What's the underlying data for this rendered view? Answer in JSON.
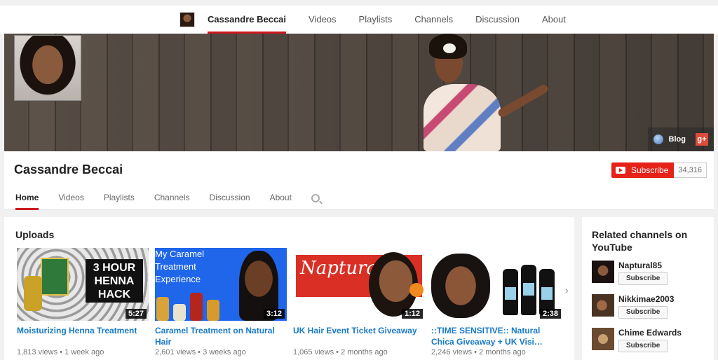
{
  "topnav": {
    "tabs": [
      {
        "label": "Cassandre Beccai",
        "active": true
      },
      {
        "label": "Videos"
      },
      {
        "label": "Playlists"
      },
      {
        "label": "Channels"
      },
      {
        "label": "Discussion"
      },
      {
        "label": "About"
      }
    ]
  },
  "banner": {
    "blog_label": "Blog",
    "gplus_label": "g+"
  },
  "channel": {
    "name": "Cassandre Beccai",
    "subscribe_label": "Subscribe",
    "subscriber_count": "34,316",
    "tabs": [
      "Home",
      "Videos",
      "Playlists",
      "Channels",
      "Discussion",
      "About"
    ]
  },
  "uploads": {
    "heading": "Uploads",
    "videos": [
      {
        "title": "Moisturizing Henna Treatment",
        "views": "1,813 views",
        "age": "1 week ago",
        "duration": "5:27",
        "thumb_text": "3 HOUR HENNA HACK"
      },
      {
        "title": "Caramel Treatment on Natural Hair",
        "views": "2,601 views",
        "age": "3 weeks ago",
        "duration": "3:12",
        "thumb_text": "My Caramel Treatment Experience"
      },
      {
        "title": "UK Hair Event Ticket Giveaway",
        "views": "1,065 views",
        "age": "2 months ago",
        "duration": "1:12",
        "thumb_text": "Napturally"
      },
      {
        "title": "::TIME SENSITIVE:: Natural Chica Giveaway + UK Visi…",
        "views": "2,246 views",
        "age": "2 months ago",
        "duration": "2:38"
      }
    ]
  },
  "related": {
    "heading": "Related channels on YouTube",
    "subscribe_label": "Subscribe",
    "channels": [
      {
        "name": "Naptural85"
      },
      {
        "name": "Nikkimae2003"
      },
      {
        "name": "Chime Edwards"
      }
    ]
  },
  "colors": {
    "accent_red": "#cc181e",
    "subscribe_red": "#e62117",
    "link_blue": "#167ac6"
  }
}
